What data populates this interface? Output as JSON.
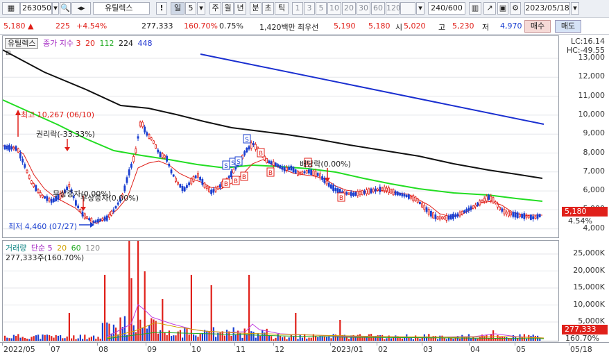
{
  "toolbar": {
    "code": "263050",
    "name": "유틸렉스",
    "period_unit": "일",
    "period_value": "5",
    "periods": [
      "주",
      "월",
      "년",
      "분",
      "초",
      "틱"
    ],
    "intervals": [
      "1",
      "3",
      "5",
      "10",
      "20",
      "30",
      "60",
      "120"
    ],
    "count": "240/600",
    "date": "2023/05/18"
  },
  "quote": {
    "price": "5,180",
    "change": "225",
    "change_pct": "+4.54%",
    "volume": "277,333",
    "volume_ratio": "160.70%",
    "turnover": "0.75%",
    "amount": "1,420백만",
    "best_label": "최우선",
    "ask": "5,190",
    "bid": "5,180",
    "open_label": "시",
    "open": "5,020",
    "high_label": "고",
    "high": "5,230",
    "low_label": "저",
    "low": "4,970",
    "buy": "매수",
    "sell": "매도"
  },
  "price_legend": {
    "name": "유틸렉스",
    "ma_label": "종가 지수",
    "ma": [
      "3",
      "20",
      "112",
      "224",
      "448"
    ]
  },
  "price_panel": {
    "lc": "LC:16.14",
    "hc": "HC:-49.55",
    "last_price": "5,180",
    "last_pct": "4.54%"
  },
  "volume_legend": {
    "label": "거래량",
    "ma_label": "단순",
    "ma": [
      "5",
      "20",
      "60",
      "120"
    ],
    "value": "277,333주(160.70%)"
  },
  "volume_panel": {
    "last_volume": "277,333",
    "last_pct": "160.70%"
  },
  "annotations": {
    "high": "최고 10,267 (06/10)",
    "low": "최저 4,460 (07/27)",
    "rights": "권리락(-33.33%)",
    "bonus": "무상증자(0.00%)",
    "bonus2": "무상증자(0.00%)",
    "dividend": "배당락(0.00%)"
  },
  "y_ticks_price": [
    "13,000",
    "12,000",
    "11,000",
    "10,000",
    "9,000",
    "8,000",
    "7,000",
    "6,000",
    "5,000",
    "4,000"
  ],
  "y_ticks_volume": [
    "25,000K",
    "20,000K",
    "15,000K",
    "10,000K",
    "5,000K"
  ],
  "x_ticks": [
    "2022/05",
    "07",
    "08",
    "09",
    "10",
    "11",
    "12",
    "2023/01",
    "02",
    "03",
    "04",
    "05",
    "05/18"
  ],
  "colors": {
    "up": "#e0201a",
    "down": "#1a3fd0",
    "ma3": "#e0201a",
    "ma20": "#e0201a",
    "ma112": "#22cc22",
    "ma224": "#111111",
    "ma448": "#1a2fd0"
  }
}
